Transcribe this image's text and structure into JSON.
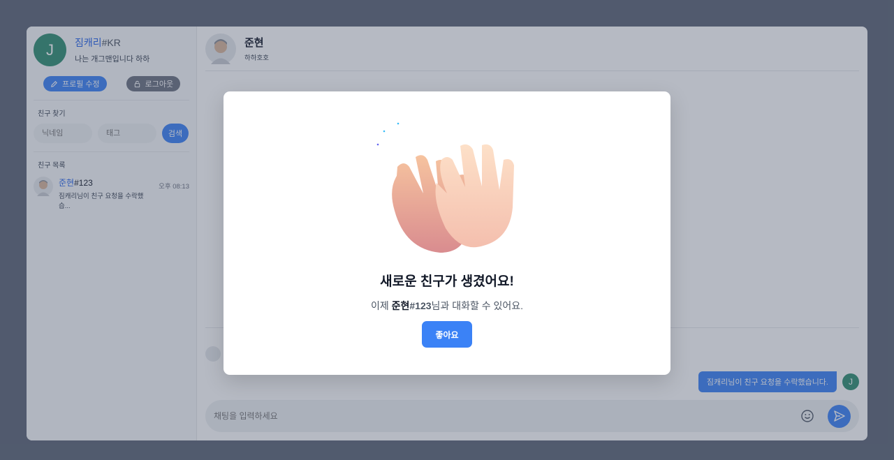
{
  "profile": {
    "avatar_initial": "J",
    "nickname": "짐캐리",
    "tag": "#KR",
    "status": "나는 개그맨입니다 하하",
    "edit_label": "프로필 수정",
    "logout_label": "로그아웃"
  },
  "find_friend": {
    "title": "친구 찾기",
    "nickname_placeholder": "닉네임",
    "tag_placeholder": "태그",
    "search_label": "검색"
  },
  "friend_list": {
    "title": "친구 목록",
    "items": [
      {
        "nickname": "준현",
        "tag": "#123",
        "last_message": "짐캐리님이 친구 요청을 수락했습...",
        "time": "오후 08:13"
      }
    ]
  },
  "chat": {
    "name": "준현",
    "status": "하하호호",
    "messages": [
      {
        "text": "짐캐리님이 친구 요청을 수락했습니다.",
        "avatar_initial": "J"
      }
    ],
    "input_placeholder": "채팅을 입력하세요"
  },
  "modal": {
    "title": "새로운 친구가 생겼어요!",
    "desc_prefix": "이제 ",
    "friend_nickname": "준현",
    "friend_tag": "#123",
    "desc_suffix": "님과 대화할 수 있어요.",
    "ok_label": "좋아요"
  },
  "colors": {
    "accent": "#3b82f6",
    "avatar": "#2f8f71",
    "overlay": "#404a60"
  }
}
